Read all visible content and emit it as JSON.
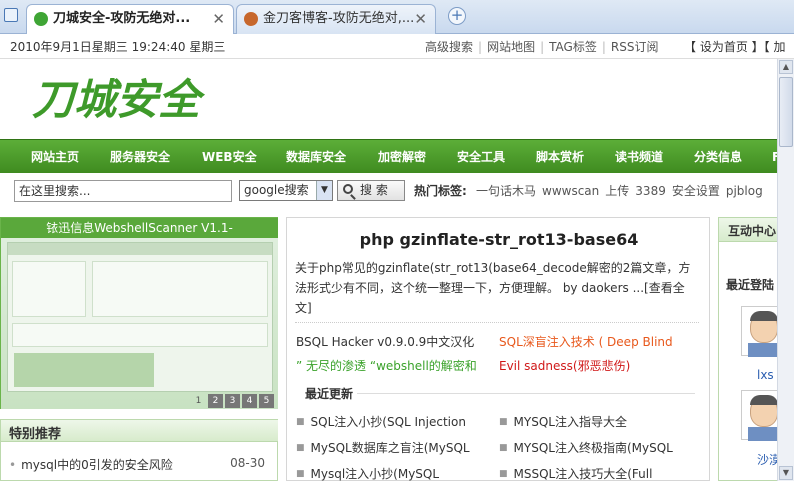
{
  "browser": {
    "tabs": [
      {
        "title": "刀城安全-攻防无绝对...",
        "active": true
      },
      {
        "title": "金刀客博客-攻防无绝对,...",
        "active": false
      }
    ],
    "close_glyph": "✕",
    "new_tab_glyph": "+"
  },
  "topbar": {
    "datetime": "2010年9月1日星期三  19:24:40 星期三",
    "links": [
      "高级搜索",
      "网站地图",
      "TAG标签",
      "RSS订阅"
    ],
    "sep": "|",
    "set_links": "【 设为首页 】【 加"
  },
  "logo": {
    "text": "刀城安全"
  },
  "nav": {
    "items": [
      "网站主页",
      "服务器安全",
      "WEB安全",
      "数据库安全",
      "加密解密",
      "安全工具",
      "脚本赏析",
      "读书频道",
      "分类信息",
      "F"
    ]
  },
  "search": {
    "input_value": "在这里搜索...",
    "engine": "google搜索",
    "button_label": "搜 索",
    "hot_label": "热门标签:",
    "hot_tags": [
      "一句话木马",
      "wwwscan",
      "上传",
      "3389",
      "安全设置",
      "pjblog"
    ]
  },
  "slideshow": {
    "title": "铱迅信息WebshellScanner V1.1-",
    "pages": [
      "1",
      "2",
      "3",
      "4",
      "5"
    ]
  },
  "recommend": {
    "title": "特别推荐",
    "items": [
      {
        "text": "mysql中的0引发的安全风险",
        "date": "08-30"
      }
    ]
  },
  "article": {
    "title": "php gzinflate-str_rot13-base64",
    "summary": "关于php常见的gzinflate(str_rot13(base64_decode解密的2篇文章，方法形式少有不同，这个统一整理一下，方便理解。 by daokers ...[查看全文]",
    "links": [
      {
        "text": "BSQL Hacker v0.9.0.9中文汉化",
        "color": "#333333"
      },
      {
        "text": "SQL深盲注入技术 ( Deep Blind",
        "color": "#e8581c"
      },
      {
        "text": "” 无尽的渗透 “webshell的解密和",
        "color": "#3aa22a"
      },
      {
        "text": "Evil sadness(邪恶悲伤)",
        "color": "#d01818"
      }
    ]
  },
  "latest": {
    "title": "最近更新",
    "bullet": "■",
    "items": [
      "SQL注入小抄(SQL Injection",
      "MYSQL注入指导大全",
      "MySQL数据库之盲注(MySQL",
      "MYSQL注入终极指南(MySQL",
      "Mysql注入小抄(MySQL",
      "MSSQL注入技巧大全(Full"
    ]
  },
  "interaction": {
    "title": "互动中心",
    "recent_login": "最近登陆",
    "users": [
      "lxs",
      "沙漠"
    ]
  },
  "colors": {
    "nav_green": "#4a9a2a",
    "slide_title": "#5aa83b"
  }
}
